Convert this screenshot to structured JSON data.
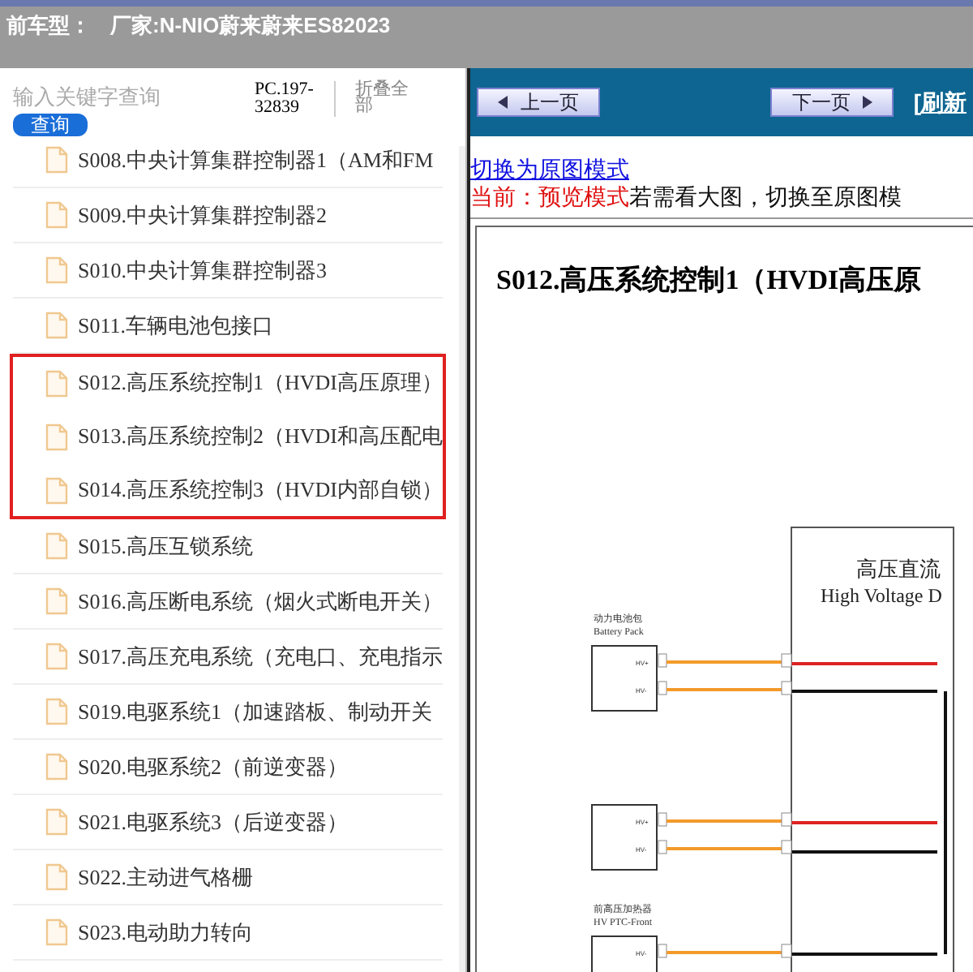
{
  "header": {
    "title": "前车型：",
    "maker": "厂家:N-NIO蔚来蔚来ES82023"
  },
  "search": {
    "placeholder": "输入关键字查询",
    "button": "查询",
    "code": "PC.197-32839",
    "collapse": "折叠全部"
  },
  "tree": [
    {
      "label": "S008.中央计算集群控制器1（AM和FM",
      "highlighted": false
    },
    {
      "label": "S009.中央计算集群控制器2",
      "highlighted": false
    },
    {
      "label": "S010.中央计算集群控制器3",
      "highlighted": false
    },
    {
      "label": "S011.车辆电池包接口",
      "highlighted": false
    },
    {
      "label": "S012.高压系统控制1（HVDI高压原理）",
      "highlighted": true
    },
    {
      "label": "S013.高压系统控制2（HVDI和高压配电",
      "highlighted": true
    },
    {
      "label": "S014.高压系统控制3（HVDI内部自锁）",
      "highlighted": true
    },
    {
      "label": "S015.高压互锁系统",
      "highlighted": false
    },
    {
      "label": "S016.高压断电系统（烟火式断电开关）",
      "highlighted": false
    },
    {
      "label": "S017.高压充电系统（充电口、充电指示",
      "highlighted": false
    },
    {
      "label": "S019.电驱系统1（加速踏板、制动开关",
      "highlighted": false
    },
    {
      "label": "S020.电驱系统2（前逆变器）",
      "highlighted": false
    },
    {
      "label": "S021.电驱系统3（后逆变器）",
      "highlighted": false
    },
    {
      "label": "S022.主动进气格栅",
      "highlighted": false
    },
    {
      "label": "S023.电动助力转向",
      "highlighted": false
    }
  ],
  "toolbar": {
    "prev": "上一页",
    "next": "下一页",
    "refresh": "[刷新"
  },
  "mode": {
    "link": "切换为原图模式",
    "current": "当前：预览模式",
    "hint": "若需看大图，切换至原图模"
  },
  "document": {
    "heading": "S012.高压系统控制1（HVDI高压原",
    "diagram": {
      "title_cn": "高压直流",
      "title_en": "High Voltage D",
      "components": [
        {
          "label_cn": "动力电池包",
          "label_en": "Battery Pack",
          "pins": [
            "HV+",
            "HV-"
          ]
        },
        {
          "pins": [
            "HV+",
            "HV-"
          ]
        },
        {
          "label_cn": "前高压加热器",
          "label_en": "HV PTC-Front",
          "pins": [
            "HV-"
          ]
        }
      ]
    }
  }
}
